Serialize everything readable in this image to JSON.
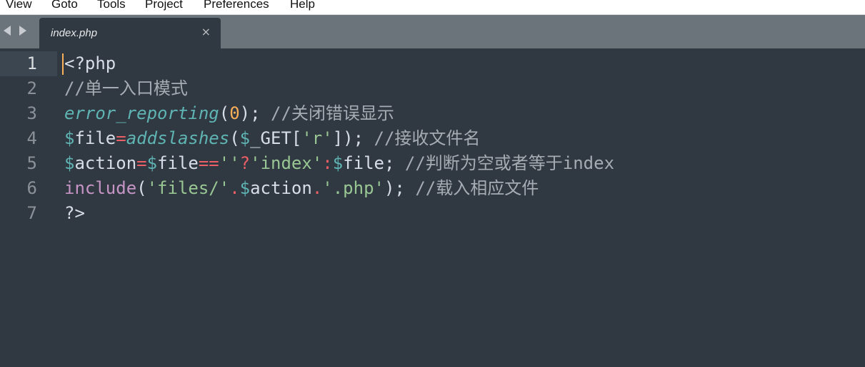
{
  "menubar": {
    "items": [
      {
        "label": "View"
      },
      {
        "label": "Goto"
      },
      {
        "label": "Tools"
      },
      {
        "label": "Project"
      },
      {
        "label": "Preferences"
      },
      {
        "label": "Help"
      }
    ]
  },
  "tabbar": {
    "active_tab": {
      "title": "index.php",
      "close_glyph": "×"
    }
  },
  "editor": {
    "line_numbers": [
      "1",
      "2",
      "3",
      "4",
      "5",
      "6",
      "7"
    ],
    "active_line": "1",
    "lines": [
      {
        "tokens": [
          {
            "t": "<?php",
            "c": "plain"
          }
        ]
      },
      {
        "tokens": [
          {
            "t": "//单一入口模式",
            "c": "comment"
          }
        ]
      },
      {
        "tokens": [
          {
            "t": "error_reporting",
            "c": "func"
          },
          {
            "t": "(",
            "c": "plain"
          },
          {
            "t": "0",
            "c": "number"
          },
          {
            "t": "); ",
            "c": "plain"
          },
          {
            "t": "//关闭错误显示",
            "c": "comment"
          }
        ]
      },
      {
        "tokens": [
          {
            "t": "$",
            "c": "var"
          },
          {
            "t": "file",
            "c": "plain"
          },
          {
            "t": "=",
            "c": "op"
          },
          {
            "t": "addslashes",
            "c": "func"
          },
          {
            "t": "(",
            "c": "plain"
          },
          {
            "t": "$",
            "c": "var"
          },
          {
            "t": "_GET",
            "c": "plain"
          },
          {
            "t": "[",
            "c": "plain"
          },
          {
            "t": "'r'",
            "c": "string"
          },
          {
            "t": "]); ",
            "c": "plain"
          },
          {
            "t": "//接收文件名",
            "c": "comment"
          }
        ]
      },
      {
        "tokens": [
          {
            "t": "$",
            "c": "var"
          },
          {
            "t": "action",
            "c": "plain"
          },
          {
            "t": "=",
            "c": "op"
          },
          {
            "t": "$",
            "c": "var"
          },
          {
            "t": "file",
            "c": "plain"
          },
          {
            "t": "==",
            "c": "op"
          },
          {
            "t": "''",
            "c": "string"
          },
          {
            "t": "?",
            "c": "op"
          },
          {
            "t": "'index'",
            "c": "string"
          },
          {
            "t": ":",
            "c": "op"
          },
          {
            "t": "$",
            "c": "var"
          },
          {
            "t": "file",
            "c": "plain"
          },
          {
            "t": "; ",
            "c": "plain"
          },
          {
            "t": "//判断为空或者等于index",
            "c": "comment"
          }
        ]
      },
      {
        "tokens": [
          {
            "t": "include",
            "c": "keyword"
          },
          {
            "t": "(",
            "c": "plain"
          },
          {
            "t": "'files/'",
            "c": "string"
          },
          {
            "t": ".",
            "c": "op"
          },
          {
            "t": "$",
            "c": "var"
          },
          {
            "t": "action",
            "c": "plain"
          },
          {
            "t": ".",
            "c": "op"
          },
          {
            "t": "'.php'",
            "c": "string"
          },
          {
            "t": "); ",
            "c": "plain"
          },
          {
            "t": "//载入相应文件",
            "c": "comment"
          }
        ]
      },
      {
        "tokens": [
          {
            "t": "?>",
            "c": "plain"
          }
        ]
      }
    ]
  },
  "colors": {
    "editor_bg": "#303841",
    "tabbar_bg": "#6b737b",
    "cursor": "#f9ae58",
    "comment": "#a6acb3",
    "function": "#5fb4b4",
    "string": "#99c794",
    "operator": "#ec5f66",
    "keyword": "#c695c6",
    "number": "#f9ae58"
  }
}
